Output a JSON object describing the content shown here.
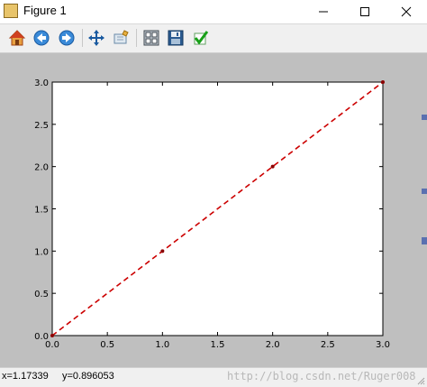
{
  "window": {
    "title": "Figure 1",
    "controls": [
      "minimize",
      "maximize",
      "close"
    ]
  },
  "toolbar": {
    "buttons": [
      {
        "name": "home",
        "icon": "home-icon"
      },
      {
        "name": "back",
        "icon": "arrow-left-icon"
      },
      {
        "name": "forward",
        "icon": "arrow-right-icon"
      },
      {
        "name": "pan",
        "icon": "move-icon"
      },
      {
        "name": "zoom",
        "icon": "zoom-rect-icon"
      },
      {
        "name": "subplots",
        "icon": "subplots-icon"
      },
      {
        "name": "save",
        "icon": "floppy-icon"
      },
      {
        "name": "edit",
        "icon": "check-icon"
      }
    ]
  },
  "status": {
    "coords": "x=1.17339     y=0.896053",
    "watermark": "http://blog.csdn.net/Ruger008"
  },
  "chart_data": {
    "type": "line",
    "x": [
      0,
      1,
      2,
      3
    ],
    "y": [
      0,
      1,
      2,
      3
    ],
    "line_style": "dashed",
    "color": "#cc0000",
    "marker": "o",
    "xlim": [
      0.0,
      3.0
    ],
    "ylim": [
      0.0,
      3.0
    ],
    "xticks": [
      "0.0",
      "0.5",
      "1.0",
      "1.5",
      "2.0",
      "2.5",
      "3.0"
    ],
    "yticks": [
      "0.0",
      "0.5",
      "1.0",
      "1.5",
      "2.0",
      "2.5",
      "3.0"
    ],
    "grid": false
  },
  "colors": {
    "figure_bg": "#bfbfbf",
    "axes_bg": "#ffffff",
    "line": "#cc0000"
  }
}
